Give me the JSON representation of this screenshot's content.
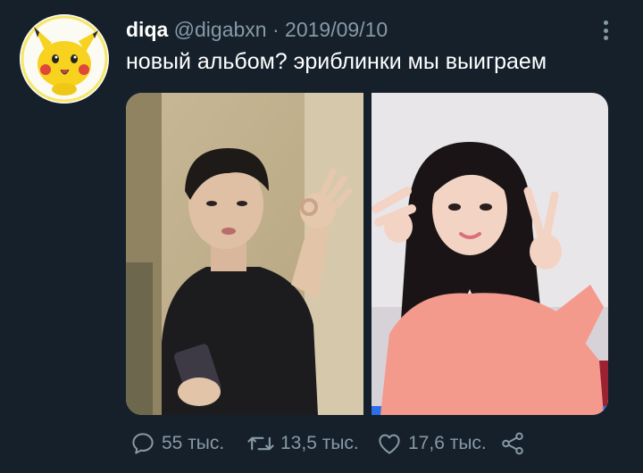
{
  "tweet": {
    "display_name": "diqa",
    "handle": "@digabxn",
    "separator": "·",
    "date": "2019/09/10",
    "text": "новый альбом? эриблинки мы выиграем"
  },
  "media": {
    "left_photo": "photo-man-ok-gesture",
    "right_photo": "photo-woman-peace-gesture"
  },
  "actions": {
    "replies": "55 тыс.",
    "retweets": "13,5 тыс.",
    "likes": "17,6 тыс."
  },
  "colors": {
    "background": "#15202b",
    "secondary_text": "#8899a6",
    "primary_text": "#ffffff"
  }
}
